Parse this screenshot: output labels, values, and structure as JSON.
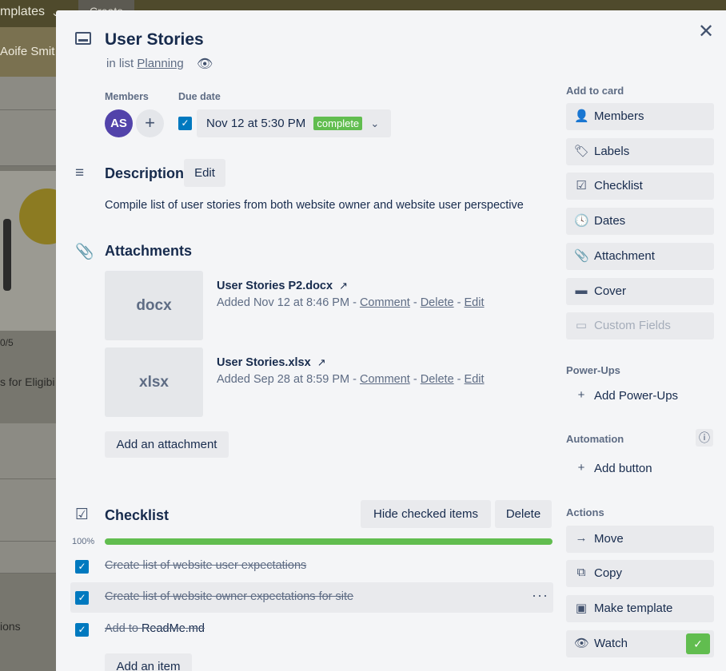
{
  "background": {
    "templates_label": "mplates",
    "create_label": "Create",
    "member_name": "Aoife Smit",
    "card_count": "0/5",
    "card_text_1": "s for Eligibi",
    "card_text_2": "ions"
  },
  "card": {
    "title": "User Stories",
    "in_list_prefix": "in list",
    "list_name": "Planning"
  },
  "members": {
    "label": "Members",
    "avatar_initials": "AS"
  },
  "due_date": {
    "label": "Due date",
    "value": "Nov 12 at 5:30 PM",
    "badge": "complete"
  },
  "description": {
    "title": "Description",
    "edit_label": "Edit",
    "text": "Compile list of user stories from both website owner and website user perspective"
  },
  "attachments": {
    "title": "Attachments",
    "items": [
      {
        "thumb": "docx",
        "name": "User Stories P2.docx",
        "added": "Added Nov 12 at 8:46 PM",
        "sep": " - ",
        "comment": "Comment",
        "delete": "Delete",
        "edit": "Edit"
      },
      {
        "thumb": "xlsx",
        "name": "User Stories.xlsx",
        "added": "Added Sep 28 at 8:59 PM",
        "sep": " - ",
        "comment": "Comment",
        "delete": "Delete",
        "edit": "Edit"
      }
    ],
    "add_label": "Add an attachment"
  },
  "checklist": {
    "title": "Checklist",
    "hide_label": "Hide checked items",
    "delete_label": "Delete",
    "progress": "100%",
    "progress_value": 100,
    "items": [
      {
        "text": "Create list of website user expectations"
      },
      {
        "text": "Create list of website owner expectations for site"
      },
      {
        "text_prefix": "Add to ",
        "link": "ReadMe.md"
      }
    ],
    "add_label": "Add an item"
  },
  "sidebar": {
    "add_to_card": "Add to card",
    "members": "Members",
    "labels": "Labels",
    "checklist": "Checklist",
    "dates": "Dates",
    "attachment": "Attachment",
    "cover": "Cover",
    "custom_fields": "Custom Fields",
    "power_ups_head": "Power-Ups",
    "add_power_ups": "Add Power-Ups",
    "automation_head": "Automation",
    "add_button": "Add button",
    "actions_head": "Actions",
    "move": "Move",
    "copy": "Copy",
    "make_template": "Make template",
    "watch": "Watch"
  },
  "colors": {
    "complete_green": "#61bd4f",
    "check_blue": "#0079bf",
    "avatar_purple": "#5243aa"
  }
}
